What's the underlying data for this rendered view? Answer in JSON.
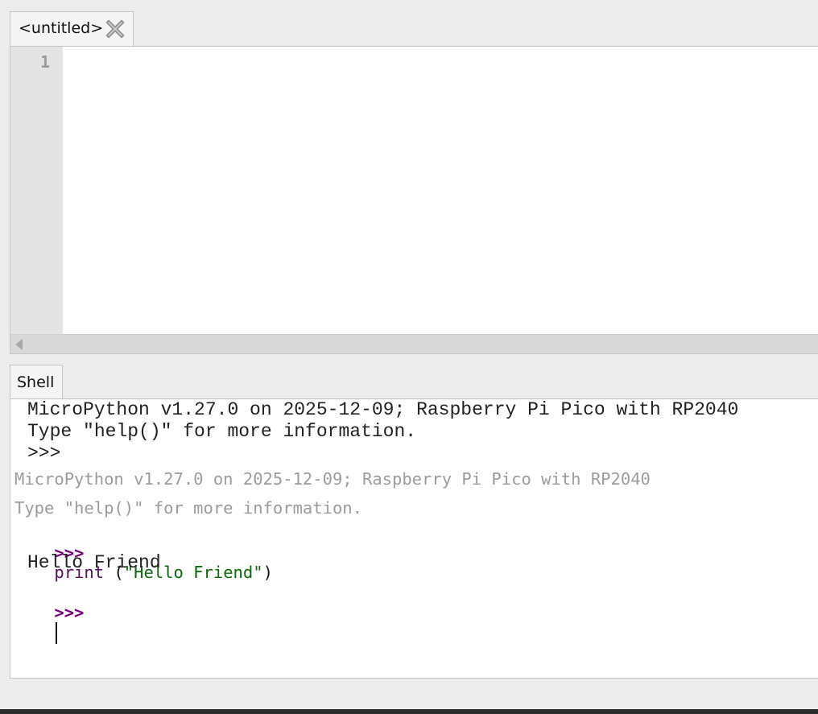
{
  "editor": {
    "tab_label": "<untitled>",
    "line_numbers": [
      "1"
    ],
    "close_icon": "close-x-icon"
  },
  "shell": {
    "tab_label": "Shell",
    "banner_lines": [
      "MicroPython v1.27.0 on 2025-12-09; Raspberry Pi Pico with RP2040",
      "Type \"help()\" for more information.",
      ">>>"
    ],
    "info_lines": [
      "MicroPython v1.27.0 on 2025-12-09; Raspberry Pi Pico with RP2040",
      "Type \"help()\" for more information."
    ],
    "command": {
      "prompt": ">>>",
      "func": "print",
      "open": " (",
      "arg": "\"Hello Friend\"",
      "close": ")"
    },
    "output": "Hello Friend",
    "current_prompt": ">>>"
  },
  "colors": {
    "prompt": "#78007a",
    "string": "#0b6a0b",
    "info_text": "#9c9c9c",
    "gutter": "#e4e4e4"
  }
}
